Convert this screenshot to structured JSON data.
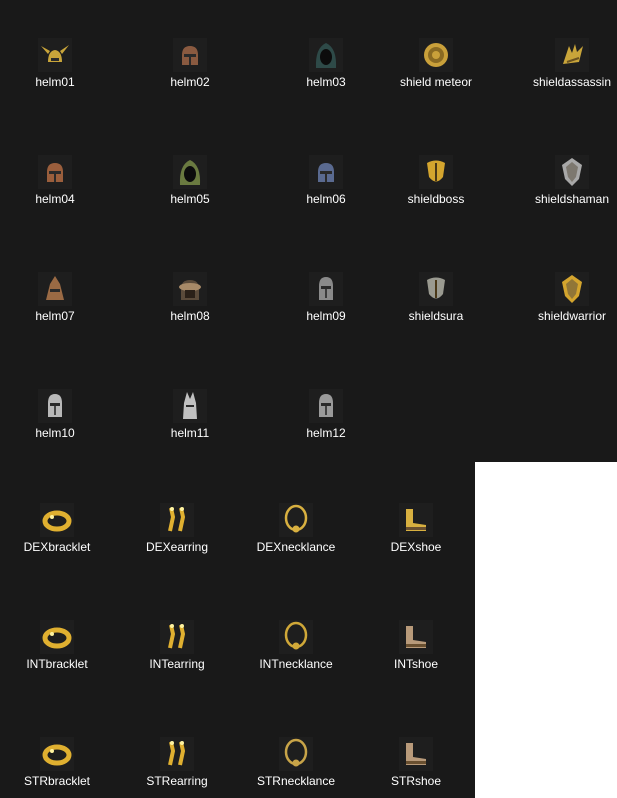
{
  "files": [
    {
      "name": "helm01",
      "icon": "winged-helm-icon",
      "color": "#c9a53a"
    },
    {
      "name": "helm02",
      "icon": "round-helm-icon",
      "color": "#8a5a40"
    },
    {
      "name": "helm03",
      "icon": "hood-helm-icon",
      "color": "#2e4a48"
    },
    {
      "name": "shield meteor",
      "icon": "round-shield-icon",
      "color": "#c9a03a"
    },
    {
      "name": "shieldassassin",
      "icon": "claw-shield-icon",
      "color": "#c9a53a"
    },
    {
      "name": "helm04",
      "icon": "round-helm-icon",
      "color": "#9a5e3c"
    },
    {
      "name": "helm05",
      "icon": "hood-helm-icon",
      "color": "#6a7a40"
    },
    {
      "name": "helm06",
      "icon": "round-helm-icon",
      "color": "#5a6a90"
    },
    {
      "name": "shieldboss",
      "icon": "crest-shield-icon",
      "color": "#d4a52e"
    },
    {
      "name": "shieldshaman",
      "icon": "kite-shield-icon",
      "color": "#a8a8a8"
    },
    {
      "name": "helm07",
      "icon": "pointed-helm-icon",
      "color": "#9a6a44"
    },
    {
      "name": "helm08",
      "icon": "fur-helm-icon",
      "color": "#a88a68"
    },
    {
      "name": "helm09",
      "icon": "knight-helm-icon",
      "color": "#8a8a8a"
    },
    {
      "name": "shieldsura",
      "icon": "crest-shield-icon",
      "color": "#9a9a90"
    },
    {
      "name": "shieldwarrior",
      "icon": "kite-shield-icon",
      "color": "#d4a52e"
    },
    {
      "name": "helm10",
      "icon": "knight-helm-icon",
      "color": "#b8b8b8"
    },
    {
      "name": "helm11",
      "icon": "spiked-helm-icon",
      "color": "#c0c0c0"
    },
    {
      "name": "helm12",
      "icon": "knight-helm-icon",
      "color": "#9a9a9a"
    },
    {
      "name": "DEXbracklet",
      "icon": "bracelet-icon",
      "color": "#e0b030"
    },
    {
      "name": "DEXearring",
      "icon": "earring-icon",
      "color": "#e0b030"
    },
    {
      "name": "DEXnecklance",
      "icon": "necklace-icon",
      "color": "#d8b040"
    },
    {
      "name": "DEXshoe",
      "icon": "shoe-icon",
      "color": "#d8b040"
    },
    {
      "name": "INTbracklet",
      "icon": "bracelet-icon",
      "color": "#e0b030"
    },
    {
      "name": "INTearring",
      "icon": "earring-icon",
      "color": "#e0b030"
    },
    {
      "name": "INTnecklance",
      "icon": "necklace-icon",
      "color": "#d0a838"
    },
    {
      "name": "INTshoe",
      "icon": "shoe-icon",
      "color": "#b89a7a"
    },
    {
      "name": "STRbracklet",
      "icon": "bracelet-icon",
      "color": "#e0b030"
    },
    {
      "name": "STRearring",
      "icon": "earring-icon",
      "color": "#e0b030"
    },
    {
      "name": "STRnecklance",
      "icon": "necklace-icon",
      "color": "#c8a448"
    },
    {
      "name": "STRshoe",
      "icon": "shoe-icon",
      "color": "#b89a7a"
    }
  ]
}
